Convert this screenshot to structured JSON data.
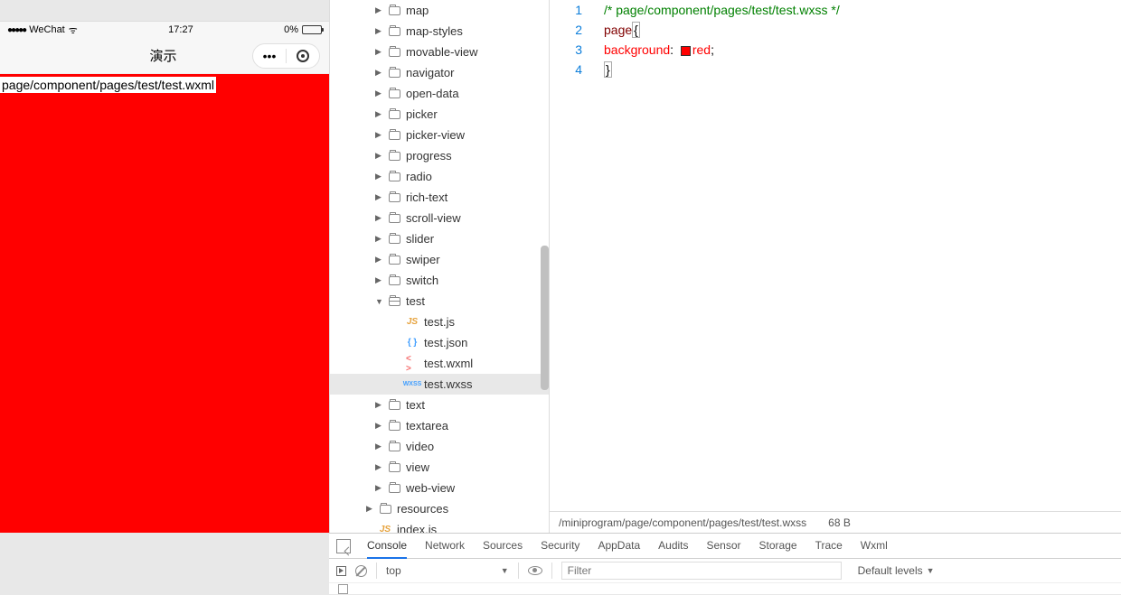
{
  "simulator": {
    "carrier_dots": "●●●●●",
    "carrier": "WeChat",
    "wifi_glyph": "ᯤ",
    "time": "17:27",
    "battery_pct": "0%",
    "nav_title": "演示",
    "menu_dots": "•••",
    "content_path": "page/component/pages/test/test.wxml"
  },
  "tree": {
    "items": [
      {
        "label": "map",
        "type": "folder",
        "indent": "indent-1",
        "expand": "▶"
      },
      {
        "label": "map-styles",
        "type": "folder",
        "indent": "indent-1",
        "expand": "▶"
      },
      {
        "label": "movable-view",
        "type": "folder",
        "indent": "indent-1",
        "expand": "▶"
      },
      {
        "label": "navigator",
        "type": "folder",
        "indent": "indent-1",
        "expand": "▶"
      },
      {
        "label": "open-data",
        "type": "folder",
        "indent": "indent-1",
        "expand": "▶"
      },
      {
        "label": "picker",
        "type": "folder",
        "indent": "indent-1",
        "expand": "▶"
      },
      {
        "label": "picker-view",
        "type": "folder",
        "indent": "indent-1",
        "expand": "▶"
      },
      {
        "label": "progress",
        "type": "folder",
        "indent": "indent-1",
        "expand": "▶"
      },
      {
        "label": "radio",
        "type": "folder",
        "indent": "indent-1",
        "expand": "▶"
      },
      {
        "label": "rich-text",
        "type": "folder",
        "indent": "indent-1",
        "expand": "▶"
      },
      {
        "label": "scroll-view",
        "type": "folder",
        "indent": "indent-1",
        "expand": "▶"
      },
      {
        "label": "slider",
        "type": "folder",
        "indent": "indent-1",
        "expand": "▶"
      },
      {
        "label": "swiper",
        "type": "folder",
        "indent": "indent-1",
        "expand": "▶"
      },
      {
        "label": "switch",
        "type": "folder",
        "indent": "indent-1",
        "expand": "▶"
      },
      {
        "label": "test",
        "type": "folder-open",
        "indent": "indent-1",
        "expand": "▼"
      },
      {
        "label": "test.js",
        "type": "js",
        "indent": "indent-2",
        "expand": ""
      },
      {
        "label": "test.json",
        "type": "json",
        "indent": "indent-2",
        "expand": ""
      },
      {
        "label": "test.wxml",
        "type": "wxml",
        "indent": "indent-2",
        "expand": ""
      },
      {
        "label": "test.wxss",
        "type": "wxss",
        "indent": "indent-2",
        "expand": "",
        "selected": true
      },
      {
        "label": "text",
        "type": "folder",
        "indent": "indent-1",
        "expand": "▶"
      },
      {
        "label": "textarea",
        "type": "folder",
        "indent": "indent-1",
        "expand": "▶"
      },
      {
        "label": "video",
        "type": "folder",
        "indent": "indent-1",
        "expand": "▶"
      },
      {
        "label": "view",
        "type": "folder",
        "indent": "indent-1",
        "expand": "▶"
      },
      {
        "label": "web-view",
        "type": "folder",
        "indent": "indent-1",
        "expand": "▶"
      },
      {
        "label": "resources",
        "type": "folder",
        "indent": "indent-root",
        "expand": "▶"
      },
      {
        "label": "index.js",
        "type": "js",
        "indent": "indent-root",
        "expand": ""
      }
    ]
  },
  "editor": {
    "lines": [
      "1",
      "2",
      "3",
      "4"
    ],
    "code": {
      "l1_comment": "/* page/component/pages/test/test.wxss */",
      "l2_sel": "page",
      "l2_brace": "{",
      "l3_prop": "background",
      "l3_colon": ": ",
      "l3_value": "red",
      "l3_semi": ";",
      "l4_brace": "}"
    },
    "status_path": "/miniprogram/page/component/pages/test/test.wxss",
    "status_size": "68 B"
  },
  "devtools": {
    "tabs": [
      "Console",
      "Network",
      "Sources",
      "Security",
      "AppData",
      "Audits",
      "Sensor",
      "Storage",
      "Trace",
      "Wxml"
    ],
    "active_tab": 0,
    "context": "top",
    "filter_placeholder": "Filter",
    "levels": "Default levels",
    "levels_chevron": "▼"
  }
}
